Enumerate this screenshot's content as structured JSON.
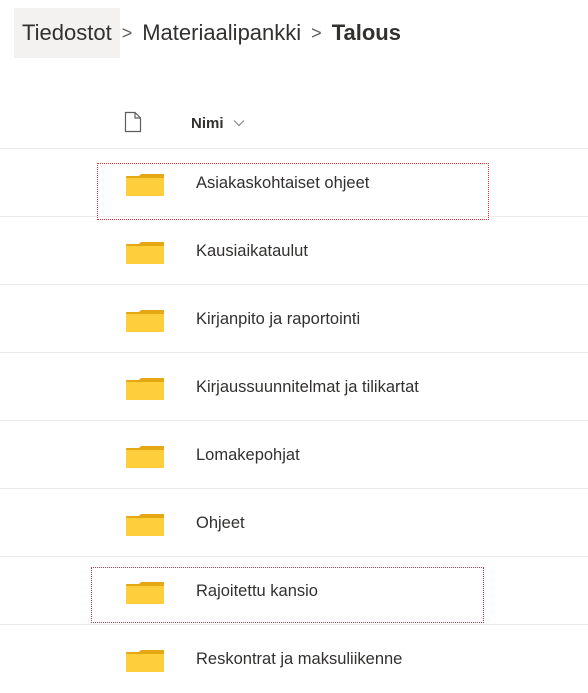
{
  "breadcrumb": {
    "items": [
      "Tiedostot",
      "Materiaalipankki",
      "Talous"
    ],
    "separator": ">"
  },
  "header": {
    "file_type_icon": "document-icon",
    "name_label": "Nimi",
    "sort_icon": "chevron-down-icon"
  },
  "colors": {
    "folder": "#ffce3d",
    "folder_shadow": "#e3a812",
    "highlight": "#d13438"
  },
  "rows": [
    {
      "name": "Asiakaskohtaiset ohjeet",
      "icon": "folder-icon",
      "highlighted": true
    },
    {
      "name": "Kausiaikataulut",
      "icon": "folder-icon",
      "highlighted": false
    },
    {
      "name": "Kirjanpito ja raportointi",
      "icon": "folder-icon",
      "highlighted": false
    },
    {
      "name": "Kirjaussuunnitelmat ja tilikartat",
      "icon": "folder-icon",
      "highlighted": false
    },
    {
      "name": "Lomakepohjat",
      "icon": "folder-icon",
      "highlighted": false
    },
    {
      "name": "Ohjeet",
      "icon": "folder-icon",
      "highlighted": false
    },
    {
      "name": "Rajoitettu kansio",
      "icon": "folder-icon",
      "highlighted": true
    },
    {
      "name": "Reskontrat ja maksuliikenne",
      "icon": "folder-icon",
      "highlighted": false
    }
  ]
}
